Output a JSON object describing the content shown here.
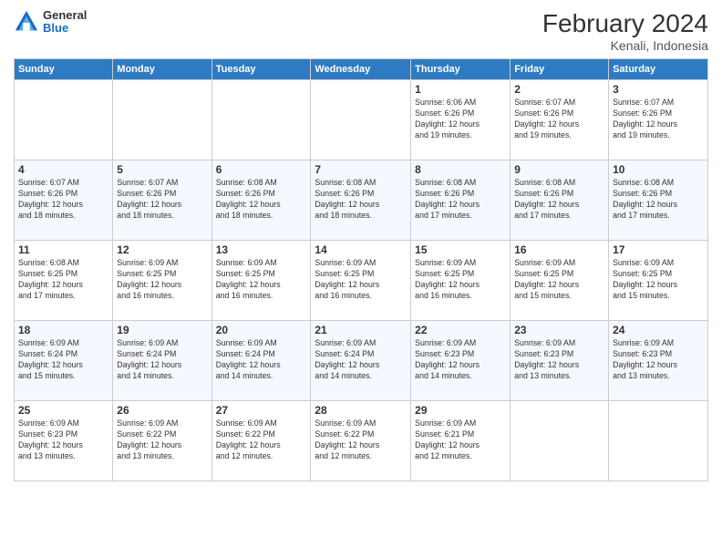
{
  "header": {
    "title": "February 2024",
    "subtitle": "Kenali, Indonesia",
    "logo_general": "General",
    "logo_blue": "Blue"
  },
  "days_of_week": [
    "Sunday",
    "Monday",
    "Tuesday",
    "Wednesday",
    "Thursday",
    "Friday",
    "Saturday"
  ],
  "weeks": [
    [
      {
        "num": "",
        "info": ""
      },
      {
        "num": "",
        "info": ""
      },
      {
        "num": "",
        "info": ""
      },
      {
        "num": "",
        "info": ""
      },
      {
        "num": "1",
        "info": "Sunrise: 6:06 AM\nSunset: 6:26 PM\nDaylight: 12 hours\nand 19 minutes."
      },
      {
        "num": "2",
        "info": "Sunrise: 6:07 AM\nSunset: 6:26 PM\nDaylight: 12 hours\nand 19 minutes."
      },
      {
        "num": "3",
        "info": "Sunrise: 6:07 AM\nSunset: 6:26 PM\nDaylight: 12 hours\nand 19 minutes."
      }
    ],
    [
      {
        "num": "4",
        "info": "Sunrise: 6:07 AM\nSunset: 6:26 PM\nDaylight: 12 hours\nand 18 minutes."
      },
      {
        "num": "5",
        "info": "Sunrise: 6:07 AM\nSunset: 6:26 PM\nDaylight: 12 hours\nand 18 minutes."
      },
      {
        "num": "6",
        "info": "Sunrise: 6:08 AM\nSunset: 6:26 PM\nDaylight: 12 hours\nand 18 minutes."
      },
      {
        "num": "7",
        "info": "Sunrise: 6:08 AM\nSunset: 6:26 PM\nDaylight: 12 hours\nand 18 minutes."
      },
      {
        "num": "8",
        "info": "Sunrise: 6:08 AM\nSunset: 6:26 PM\nDaylight: 12 hours\nand 17 minutes."
      },
      {
        "num": "9",
        "info": "Sunrise: 6:08 AM\nSunset: 6:26 PM\nDaylight: 12 hours\nand 17 minutes."
      },
      {
        "num": "10",
        "info": "Sunrise: 6:08 AM\nSunset: 6:26 PM\nDaylight: 12 hours\nand 17 minutes."
      }
    ],
    [
      {
        "num": "11",
        "info": "Sunrise: 6:08 AM\nSunset: 6:25 PM\nDaylight: 12 hours\nand 17 minutes."
      },
      {
        "num": "12",
        "info": "Sunrise: 6:09 AM\nSunset: 6:25 PM\nDaylight: 12 hours\nand 16 minutes."
      },
      {
        "num": "13",
        "info": "Sunrise: 6:09 AM\nSunset: 6:25 PM\nDaylight: 12 hours\nand 16 minutes."
      },
      {
        "num": "14",
        "info": "Sunrise: 6:09 AM\nSunset: 6:25 PM\nDaylight: 12 hours\nand 16 minutes."
      },
      {
        "num": "15",
        "info": "Sunrise: 6:09 AM\nSunset: 6:25 PM\nDaylight: 12 hours\nand 16 minutes."
      },
      {
        "num": "16",
        "info": "Sunrise: 6:09 AM\nSunset: 6:25 PM\nDaylight: 12 hours\nand 15 minutes."
      },
      {
        "num": "17",
        "info": "Sunrise: 6:09 AM\nSunset: 6:25 PM\nDaylight: 12 hours\nand 15 minutes."
      }
    ],
    [
      {
        "num": "18",
        "info": "Sunrise: 6:09 AM\nSunset: 6:24 PM\nDaylight: 12 hours\nand 15 minutes."
      },
      {
        "num": "19",
        "info": "Sunrise: 6:09 AM\nSunset: 6:24 PM\nDaylight: 12 hours\nand 14 minutes."
      },
      {
        "num": "20",
        "info": "Sunrise: 6:09 AM\nSunset: 6:24 PM\nDaylight: 12 hours\nand 14 minutes."
      },
      {
        "num": "21",
        "info": "Sunrise: 6:09 AM\nSunset: 6:24 PM\nDaylight: 12 hours\nand 14 minutes."
      },
      {
        "num": "22",
        "info": "Sunrise: 6:09 AM\nSunset: 6:23 PM\nDaylight: 12 hours\nand 14 minutes."
      },
      {
        "num": "23",
        "info": "Sunrise: 6:09 AM\nSunset: 6:23 PM\nDaylight: 12 hours\nand 13 minutes."
      },
      {
        "num": "24",
        "info": "Sunrise: 6:09 AM\nSunset: 6:23 PM\nDaylight: 12 hours\nand 13 minutes."
      }
    ],
    [
      {
        "num": "25",
        "info": "Sunrise: 6:09 AM\nSunset: 6:23 PM\nDaylight: 12 hours\nand 13 minutes."
      },
      {
        "num": "26",
        "info": "Sunrise: 6:09 AM\nSunset: 6:22 PM\nDaylight: 12 hours\nand 13 minutes."
      },
      {
        "num": "27",
        "info": "Sunrise: 6:09 AM\nSunset: 6:22 PM\nDaylight: 12 hours\nand 12 minutes."
      },
      {
        "num": "28",
        "info": "Sunrise: 6:09 AM\nSunset: 6:22 PM\nDaylight: 12 hours\nand 12 minutes."
      },
      {
        "num": "29",
        "info": "Sunrise: 6:09 AM\nSunset: 6:21 PM\nDaylight: 12 hours\nand 12 minutes."
      },
      {
        "num": "",
        "info": ""
      },
      {
        "num": "",
        "info": ""
      }
    ]
  ]
}
